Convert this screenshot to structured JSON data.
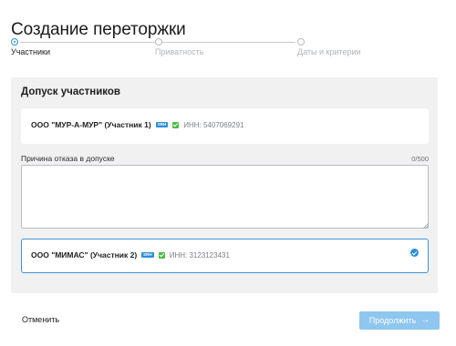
{
  "page": {
    "title": "Создание переторжки"
  },
  "stepper": {
    "steps": [
      {
        "label": "Участники",
        "active": true
      },
      {
        "label": "Приватность",
        "active": false
      },
      {
        "label": "Даты и критерии",
        "active": false
      }
    ]
  },
  "admission": {
    "title": "Допуск участников",
    "participants": [
      {
        "name": "ООО \"МУР-А-МУР\" (Участник 1)",
        "badge": "SRH",
        "inn": "ИНН: 5407069291",
        "verified": true,
        "selected": false
      },
      {
        "name": "ООО \"МИМАС\" (Участник 2)",
        "badge": "SRH",
        "inn": "ИНН: 3123123431",
        "verified": true,
        "selected": true
      }
    ],
    "reason_field": {
      "label": "Причина отказа в допуске",
      "counter": "0/500",
      "value": ""
    }
  },
  "footer": {
    "cancel_label": "Отменить",
    "continue_label": "Продолжить",
    "continue_icon": "arrow-right-icon"
  },
  "colors": {
    "accent": "#2f8fd6",
    "continue_bg": "#8fc6ef",
    "verified": "#4cbb47",
    "panel_bg": "#f1f1f1"
  }
}
